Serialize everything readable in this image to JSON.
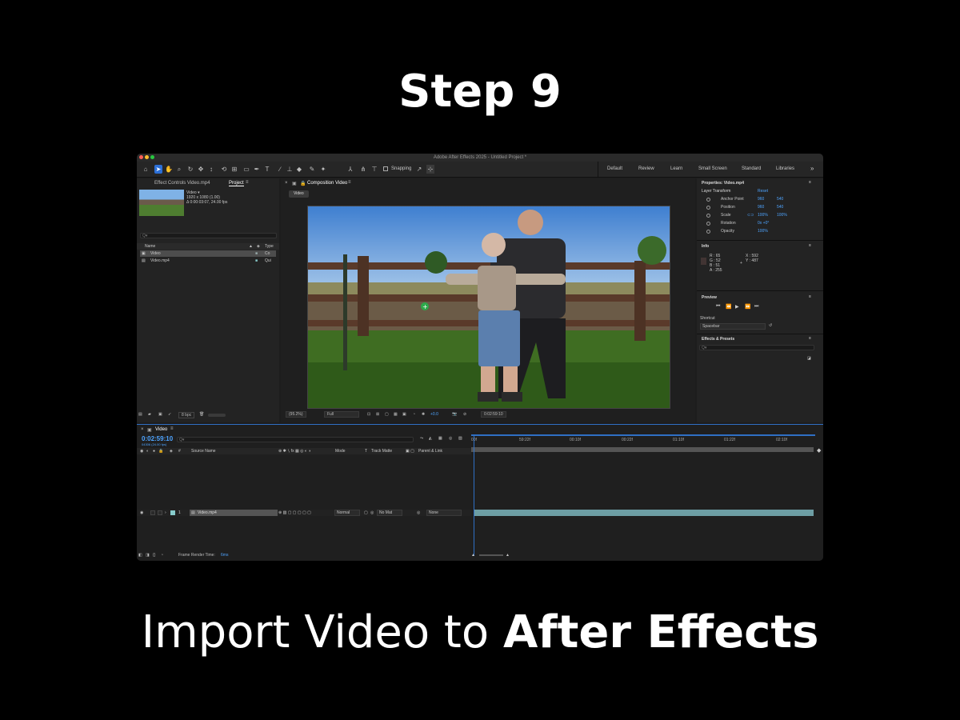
{
  "heading": {
    "step": "Step 9",
    "caption_plain": "Import Video to ",
    "caption_bold": "After Effects"
  },
  "colors": {
    "accent_blue": "#2c6fd6",
    "timecode": "#4ea4ff",
    "layer_bar": "#6d9ea4"
  },
  "app": {
    "window_title": "Adobe After Effects 2025 - Untitled Project *",
    "toolbar": {
      "tools": [
        "home-icon",
        "selection-icon",
        "hand-icon",
        "zoom-icon",
        "orbit-icon",
        "pan-icon",
        "dolly-icon",
        "rotate-icon",
        "pan-behind-icon",
        "rectangle-icon",
        "pen-icon",
        "type-icon",
        "brush-icon",
        "clone-stamp-icon",
        "eraser-icon",
        "roto-brush-icon",
        "puppet-icon"
      ],
      "snapping": "Snapping",
      "workspaces": [
        "Default",
        "Review",
        "Learn",
        "Small Screen",
        "Standard",
        "Libraries"
      ],
      "more": "»"
    },
    "project": {
      "tab_effect_controls": "Effect Controls Video.mp4",
      "tab_project": "Project",
      "item_name": "Video ▾",
      "item_res": "1920 x 1080 (1.00)",
      "item_dur": "Δ 0:00:03:07, 24.00 fps",
      "search_placeholder": "Q▾",
      "col_name": "Name",
      "col_type": "Type",
      "rows": [
        {
          "name": "Video",
          "type": "Co"
        },
        {
          "name": "Video.mp4",
          "type": "Qui"
        }
      ],
      "bpc": "8 bpc"
    },
    "composition": {
      "tab": "Composition Video",
      "chip": "Video",
      "zoom": "(95.2%)",
      "quality": "Full",
      "exposure": "+0.0",
      "timecode": "0:02:59:10"
    },
    "properties": {
      "title": "Properties: Video.mp4",
      "section": "Layer Transform",
      "reset": "Reset",
      "rows": [
        {
          "label": "Anchor Point",
          "v1": "960",
          "v2": "540"
        },
        {
          "label": "Position",
          "v1": "960",
          "v2": "540"
        },
        {
          "label": "Scale",
          "v1": "100%",
          "v2": "100%"
        },
        {
          "label": "Rotation",
          "v1": "0x +0°",
          "v2": ""
        },
        {
          "label": "Opacity",
          "v1": "100%",
          "v2": ""
        }
      ],
      "info_title": "Info",
      "info_r": "R : 65",
      "info_g": "G : 52",
      "info_b": "B : 51",
      "info_a": "A : 255",
      "info_x": "X : 592",
      "info_y": "Y : 487",
      "preview_title": "Preview",
      "shortcut_label": "Shortcut",
      "shortcut_value": "Spacebar",
      "effects_title": "Effects & Presets",
      "effects_search": "Q▾"
    },
    "timeline": {
      "tab": "Video",
      "timecode": "0:02:59:10",
      "fps": "04306 (24.00 fps)",
      "search_placeholder": "Q▾",
      "col_source": "Source Name",
      "col_mode": "Mode",
      "col_t": "T",
      "col_track": "Track Matte",
      "col_parent": "Parent & Link",
      "ruler": [
        "00f",
        "59:22f",
        "00:10f",
        "00:22f",
        "01:10f",
        "01:22f",
        "02:10f"
      ],
      "layer_num": "1",
      "layer_name": "Video.mp4",
      "layer_mode": "Normal",
      "layer_matte": "No Mat",
      "layer_parent": "None",
      "render_label": "Frame Render Time:",
      "render_value": "6ms"
    }
  }
}
